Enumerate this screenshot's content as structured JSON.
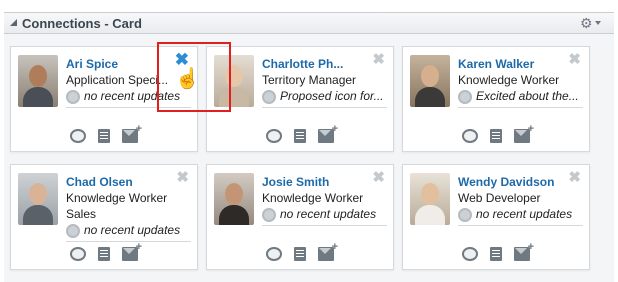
{
  "panel": {
    "title": "Connections - Card"
  },
  "cards": [
    {
      "name": "Ari Spice",
      "title": "Application Speci...",
      "status": "no recent updates",
      "close": "✖"
    },
    {
      "name": "Charlotte Ph...",
      "title": "Territory Manager",
      "status": "Proposed icon for...",
      "close": "✖"
    },
    {
      "name": "Karen Walker",
      "title": "Knowledge Worker",
      "status": "Excited about the...",
      "close": "✖"
    },
    {
      "name": "Chad Olsen",
      "title": "Knowledge Worker",
      "title2": "Sales",
      "status": "no recent updates",
      "close": "✖"
    },
    {
      "name": "Josie Smith",
      "title": "Knowledge Worker",
      "status": "no recent updates",
      "close": "✖"
    },
    {
      "name": "Wendy Davidson",
      "title": "Web Developer",
      "status": "no recent updates",
      "close": "✖"
    }
  ],
  "colors": {
    "link": "#1e6aa8",
    "highlight": "#e0201f",
    "close_active": "#2c8dd6"
  },
  "cursor": "☝"
}
